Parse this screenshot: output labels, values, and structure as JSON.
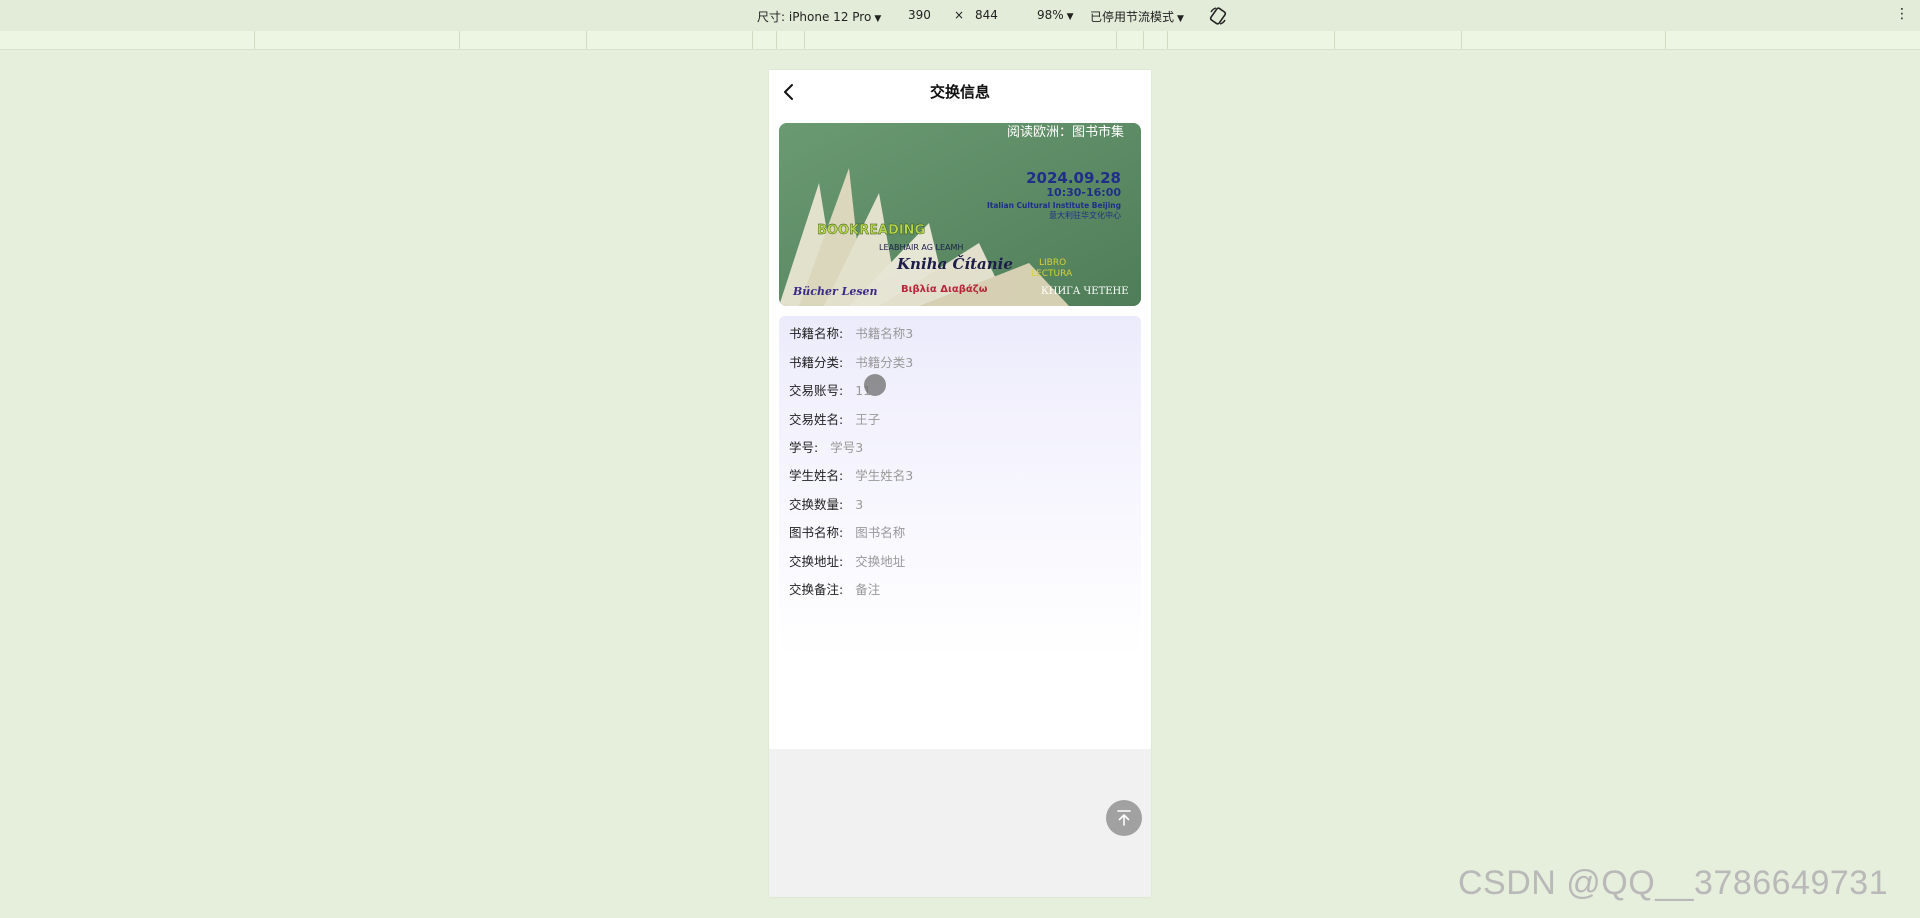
{
  "devtools": {
    "device_label": "尺寸: iPhone 12 Pro",
    "width": "390",
    "times": "×",
    "height": "844",
    "zoom": "98%",
    "throttle": "已停用节流模式"
  },
  "nav": {
    "title": "交换信息"
  },
  "banner": {
    "title": "阅读欧洲：图书市集",
    "date": "2024.09.28",
    "time": "10:30-16:00",
    "venue_en": "Italian Cultural Institute Beijing",
    "venue_cn": "意大利驻华文化中心",
    "words": [
      "BOOKREADING",
      "LEABHAIR AG LEAMH",
      "Kniha Čítanie",
      "LIBRO",
      "LECTURA",
      "Βιβλία Διαβάζω",
      "КНИГА ЧЕТЕНЕ",
      "Bücher Lesen"
    ]
  },
  "details": [
    {
      "label": "书籍名称:",
      "value": "书籍名称3"
    },
    {
      "label": "书籍分类:",
      "value": "书籍分类3"
    },
    {
      "label": "交易账号:",
      "value": "11"
    },
    {
      "label": "交易姓名:",
      "value": "王子"
    },
    {
      "label": "学号:",
      "value": "学号3"
    },
    {
      "label": "学生姓名:",
      "value": "学生姓名3"
    },
    {
      "label": "交换数量:",
      "value": "3"
    },
    {
      "label": "图书名称:",
      "value": "图书名称"
    },
    {
      "label": "交换地址:",
      "value": "交换地址"
    },
    {
      "label": "交换备注:",
      "value": "备注"
    }
  ],
  "icons": {
    "back": "chevron-left-icon",
    "to_top": "arrow-up-to-top-icon",
    "rotate": "rotate-icon",
    "more": "kebab-menu-icon"
  },
  "watermark": "CSDN @QQ__3786649731"
}
